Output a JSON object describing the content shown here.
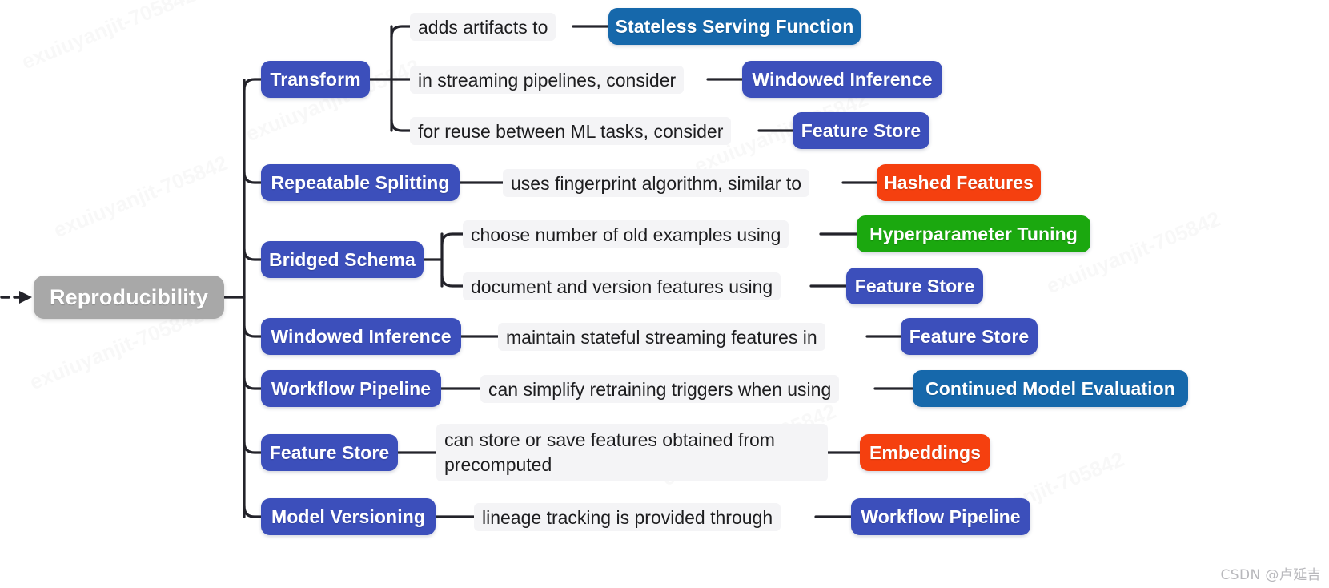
{
  "diagram": {
    "type": "mind-map",
    "root": {
      "label": "Reproducibility",
      "color": "#a8a8a8"
    },
    "incoming_arrow": "dashed-arrow-into-root",
    "branches": [
      {
        "label": "Transform",
        "color": "#3c4fbb",
        "children": [
          {
            "edge_label": "adds artifacts to",
            "target": "Stateless Serving Function",
            "target_color": "#1668ab"
          },
          {
            "edge_label": "in streaming pipelines, consider",
            "target": "Windowed Inference",
            "target_color": "#3c4fbb"
          },
          {
            "edge_label": "for reuse between ML tasks, consider",
            "target": "Feature Store",
            "target_color": "#3c4fbb"
          }
        ]
      },
      {
        "label": "Repeatable Splitting",
        "color": "#3c4fbb",
        "children": [
          {
            "edge_label": "uses fingerprint algorithm, similar to",
            "target": "Hashed Features",
            "target_color": "#f5400f"
          }
        ]
      },
      {
        "label": "Bridged Schema",
        "color": "#3c4fbb",
        "children": [
          {
            "edge_label": "choose number of old examples using",
            "target": "Hyperparameter Tuning",
            "target_color": "#1ba80f"
          },
          {
            "edge_label": "document and version features using",
            "target": "Feature Store",
            "target_color": "#3c4fbb"
          }
        ]
      },
      {
        "label": "Windowed Inference",
        "color": "#3c4fbb",
        "children": [
          {
            "edge_label": "maintain stateful streaming features in",
            "target": "Feature Store",
            "target_color": "#3c4fbb"
          }
        ]
      },
      {
        "label": "Workflow Pipeline",
        "color": "#3c4fbb",
        "children": [
          {
            "edge_label": "can simplify retraining triggers when using",
            "target": "Continued Model Evaluation",
            "target_color": "#1668ab"
          }
        ]
      },
      {
        "label": "Feature Store",
        "color": "#3c4fbb",
        "children": [
          {
            "edge_label": "can store or save features obtained from\nprecomputed",
            "target": "Embeddings",
            "target_color": "#f5400f"
          }
        ]
      },
      {
        "label": "Model Versioning",
        "color": "#3c4fbb",
        "children": [
          {
            "edge_label": "lineage tracking is provided through",
            "target": "Workflow Pipeline",
            "target_color": "#3c4fbb"
          }
        ]
      }
    ]
  },
  "watermark": {
    "text": "CSDN @卢延吉"
  },
  "ghost_watermark": {
    "text": "exuiuyanjit-705842"
  }
}
